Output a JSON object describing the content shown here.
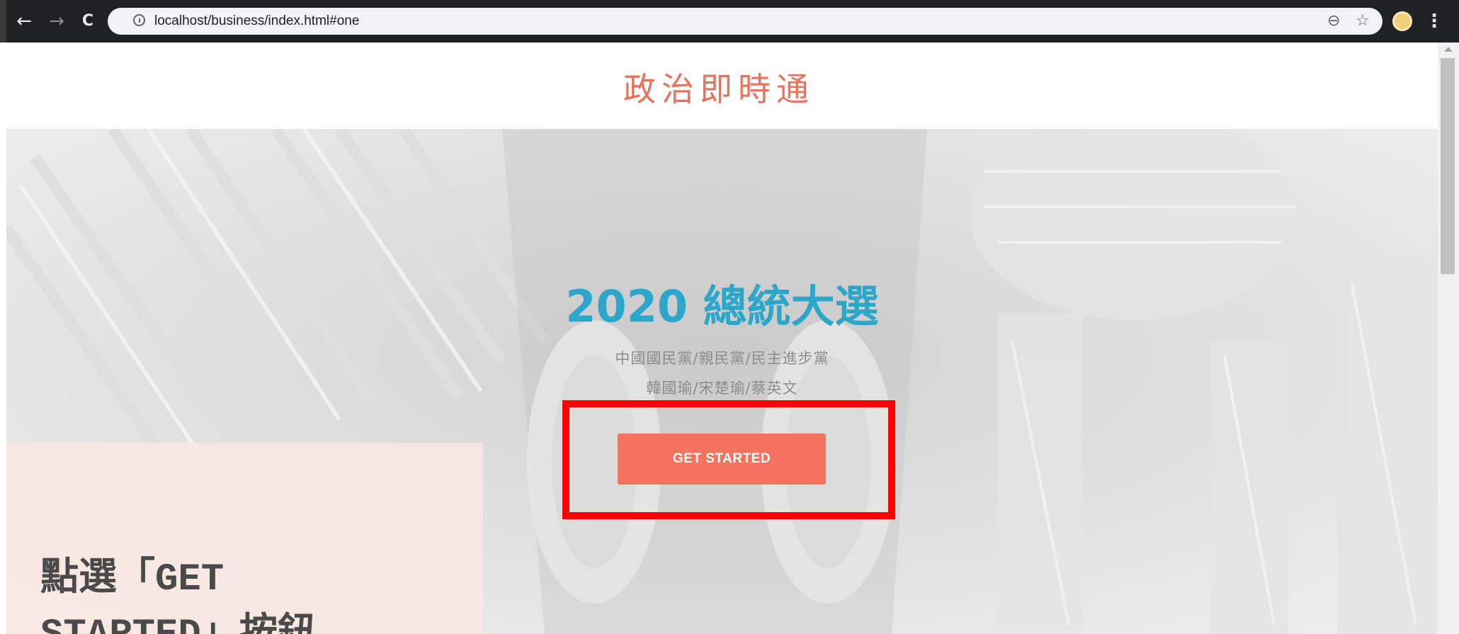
{
  "browser": {
    "url": "localhost/business/index.html#one",
    "back_glyph": "←",
    "forward_glyph": "→",
    "reload_glyph": "C",
    "zoom_glyph": "⊖",
    "star_glyph": "☆",
    "menu_glyph": "⋮"
  },
  "site": {
    "brand": "政治即時通"
  },
  "hero": {
    "title": "2020 總統大選",
    "subtitle_line1": "中國國民黨/親民黨/民主進步黨",
    "subtitle_line2": "韓國瑜/宋楚瑜/蔡英文",
    "cta_label": "GET STARTED"
  },
  "note": {
    "line1": "點選「GET",
    "line2": "STARTED」按鈕"
  },
  "colors": {
    "brand": "#e8735b",
    "title": "#2ca6c9",
    "cta": "#f3735e",
    "highlight": "#ff0000"
  }
}
